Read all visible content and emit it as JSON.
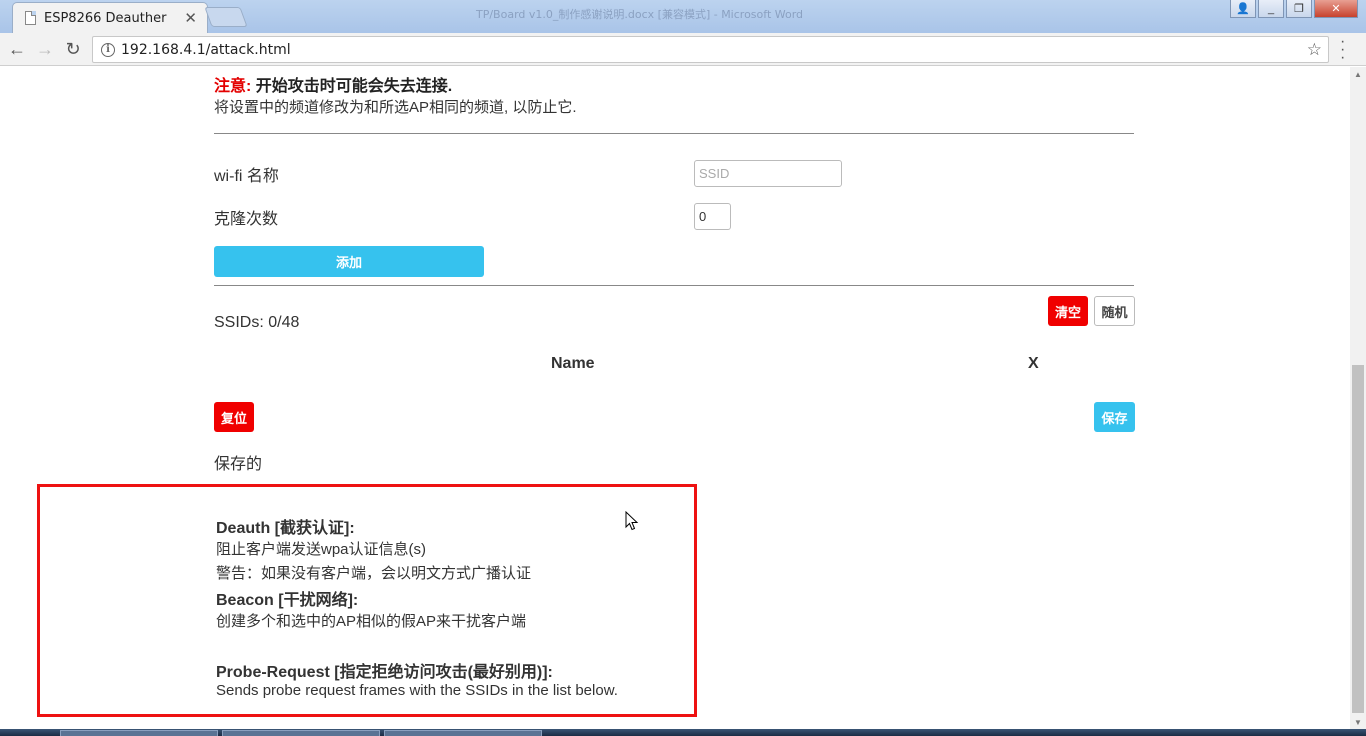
{
  "browser": {
    "tab_title": "ESP8266 Deauther",
    "tab_close": "✕",
    "background_window_title": "TP/Board v1.0_制作感谢说明.docx [兼容模式] - Microsoft Word",
    "url": "192.168.4.1/attack.html",
    "back": "←",
    "forward": "→",
    "reload": "↻",
    "star": "☆",
    "info": "i",
    "window_minimize": "_",
    "window_restore": "❐",
    "window_close": "✕"
  },
  "notice": {
    "label": "注意:",
    "text": " 开始攻击时可能会失去连接.",
    "sub": "将设置中的频道修改为和所选AP相同的频道, 以防止它."
  },
  "form": {
    "ssid_label": "wi-fi 名称",
    "ssid_placeholder": "SSID",
    "clone_label": "克隆次数",
    "clone_value": "0",
    "add_button": "添加"
  },
  "ssid_list": {
    "count_text": "SSIDs: 0/48",
    "clear_button": "清空",
    "random_button": "随机",
    "col_name": "Name",
    "col_x": "X",
    "reset_button": "复位",
    "save_button": "保存",
    "saved_text": "保存的"
  },
  "info": {
    "deauth_title": "Deauth [截获认证]:",
    "deauth_desc1": "阻止客户端发送wpa认证信息(s)",
    "deauth_desc2": "警告：如果没有客户端，会以明文方式广播认证",
    "beacon_title": "Beacon [干扰网络]:",
    "beacon_desc": "创建多个和选中的AP相似的假AP来干扰客户端",
    "probe_title": "Probe-Request [指定拒绝访问攻击(最好别用)]:",
    "probe_desc": "Sends probe request frames with the SSIDs in the list below."
  },
  "icons": {
    "page": "page-icon",
    "cursor": "mouse-pointer-icon"
  }
}
